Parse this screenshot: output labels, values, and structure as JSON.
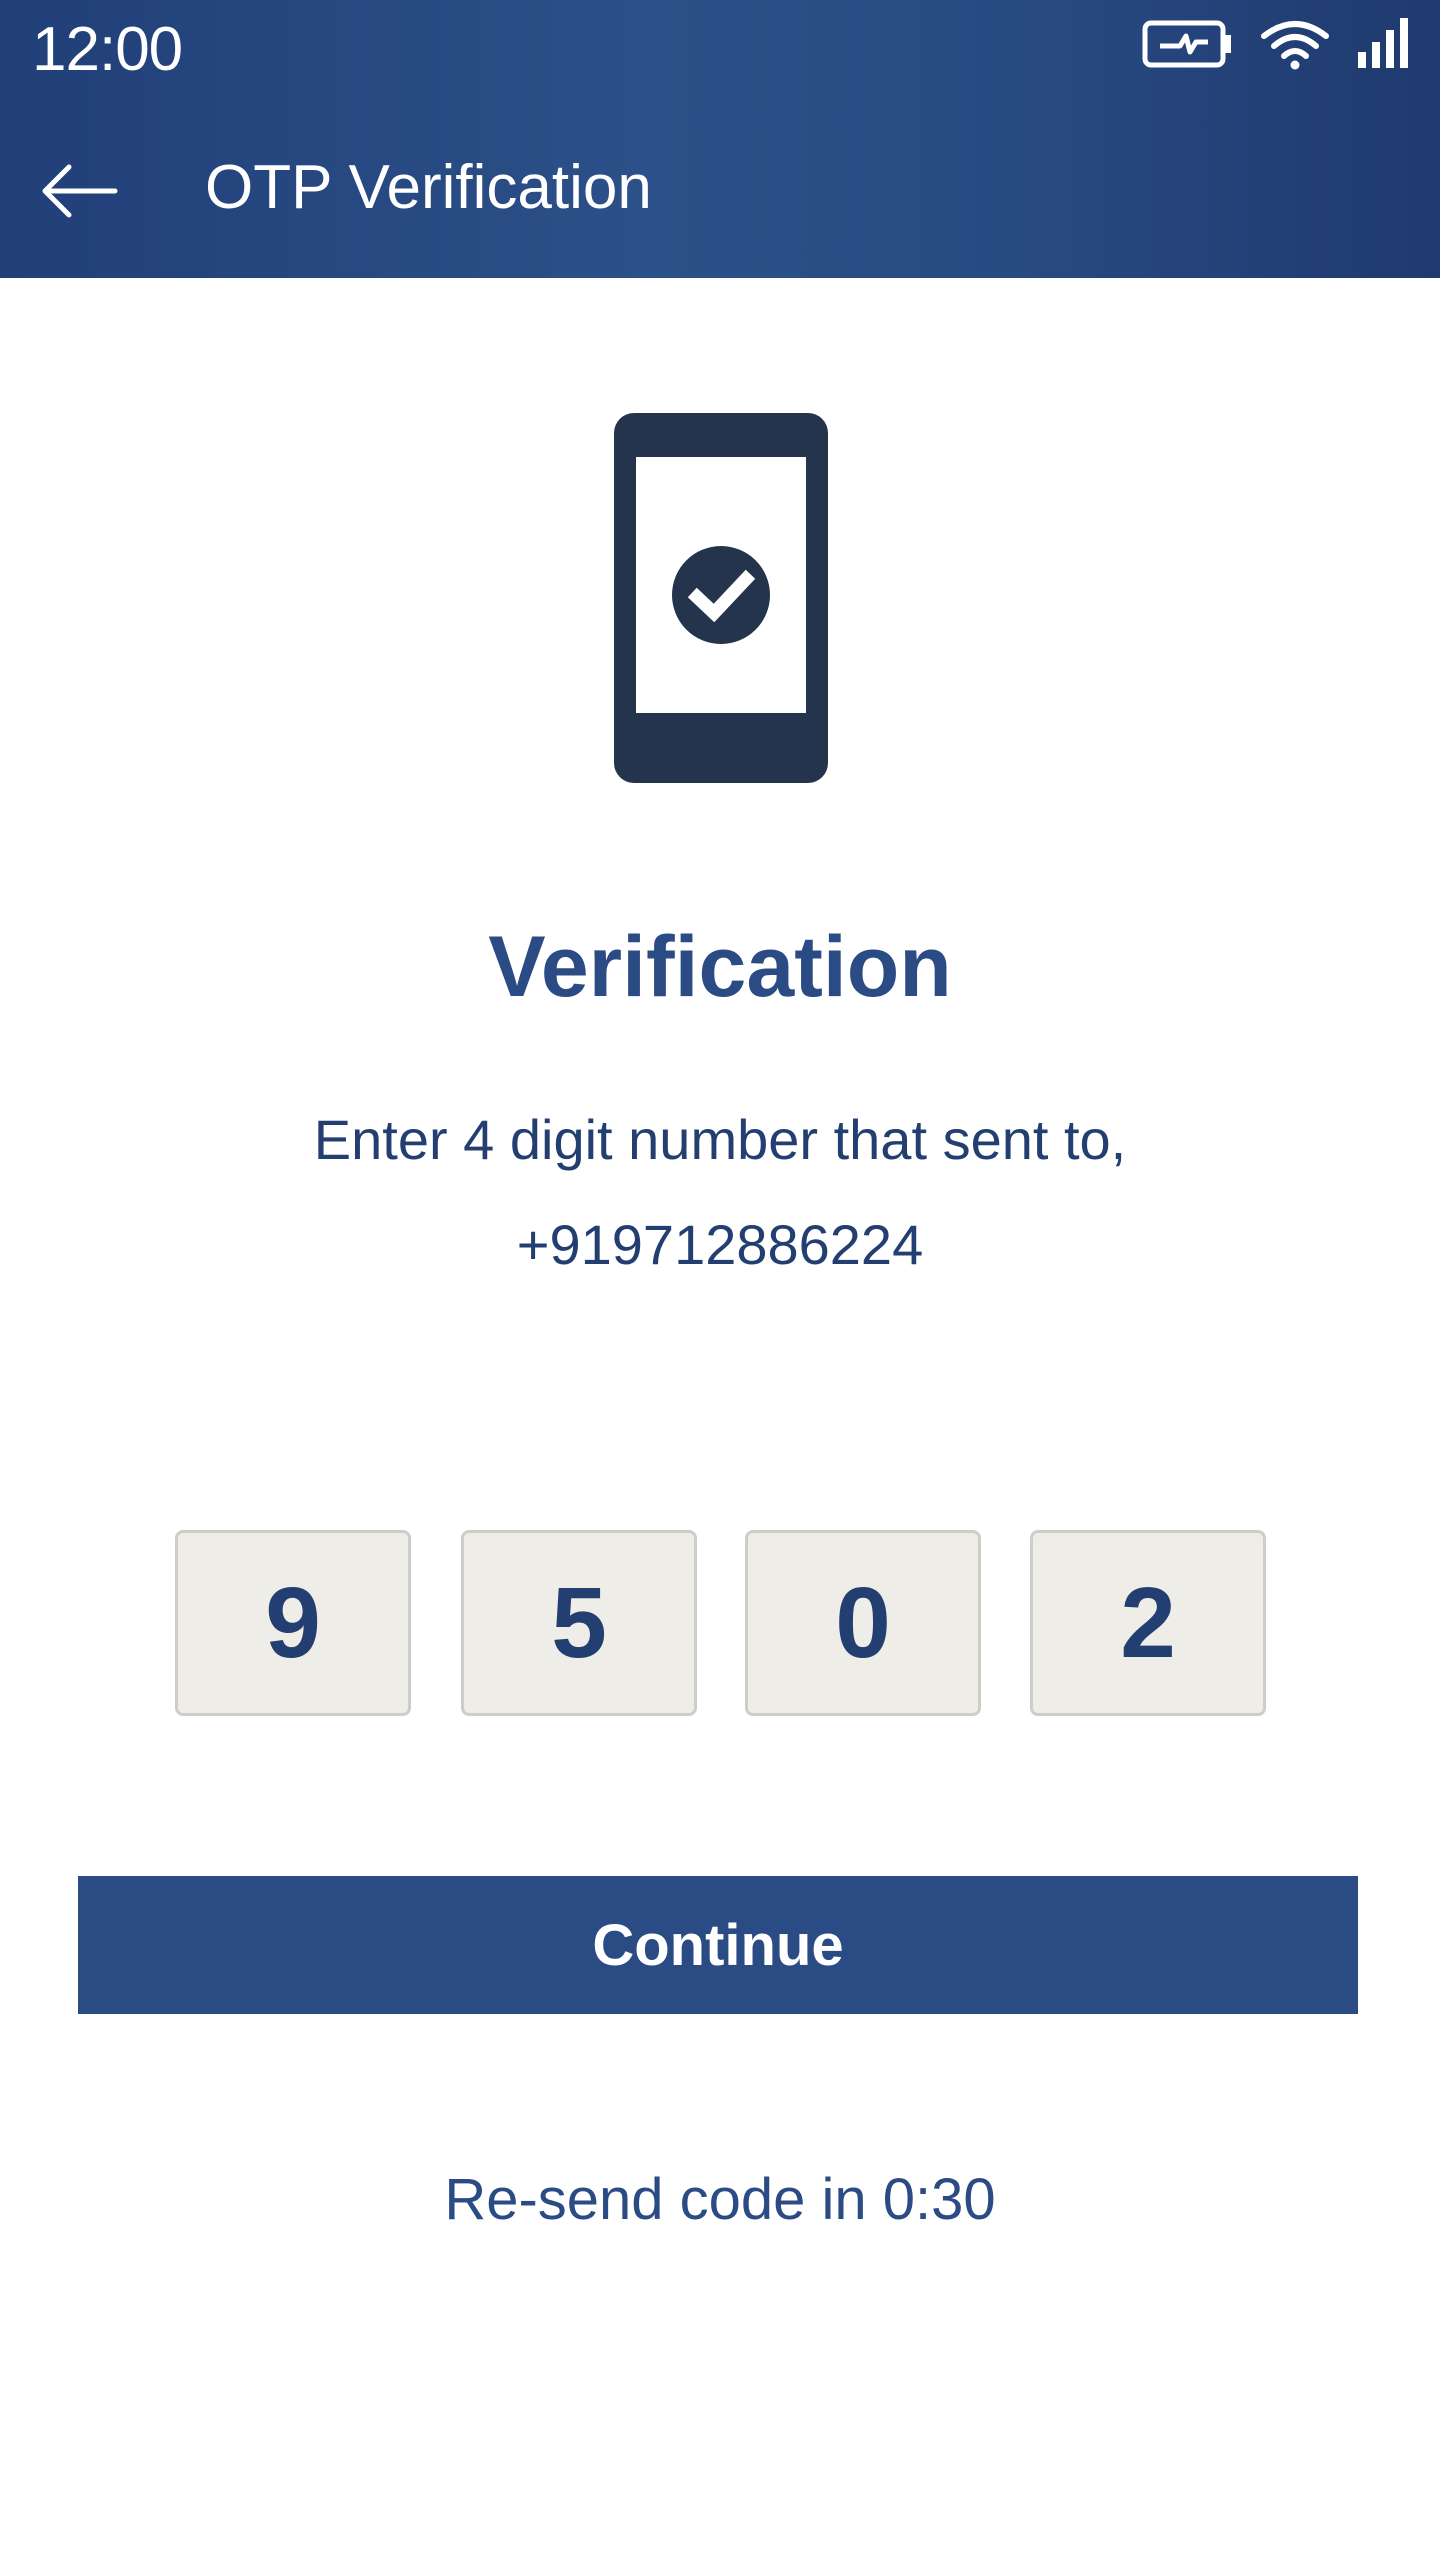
{
  "status_bar": {
    "time": "12:00",
    "icons": [
      "battery-charging-icon",
      "wifi-icon",
      "signal-icon"
    ]
  },
  "header": {
    "title": "OTP Verification",
    "back_icon": "arrow-left-icon"
  },
  "illustration": {
    "icon": "phone-check-icon"
  },
  "content": {
    "heading": "Verification",
    "instruction": "Enter 4 digit number that sent to,",
    "phone_number": "+919712886224"
  },
  "otp": {
    "digits": [
      "9",
      "5",
      "0",
      "2"
    ]
  },
  "actions": {
    "continue_label": "Continue",
    "resend_text": "Re-send code in 0:30"
  },
  "colors": {
    "header_gradient_start": "#213f78",
    "header_gradient_mid": "#2c5089",
    "primary": "#2b4b85",
    "text_dark": "#233e70",
    "illustration": "#24344d",
    "otp_box_bg": "#efede7",
    "otp_box_border": "#cfcdc8"
  }
}
